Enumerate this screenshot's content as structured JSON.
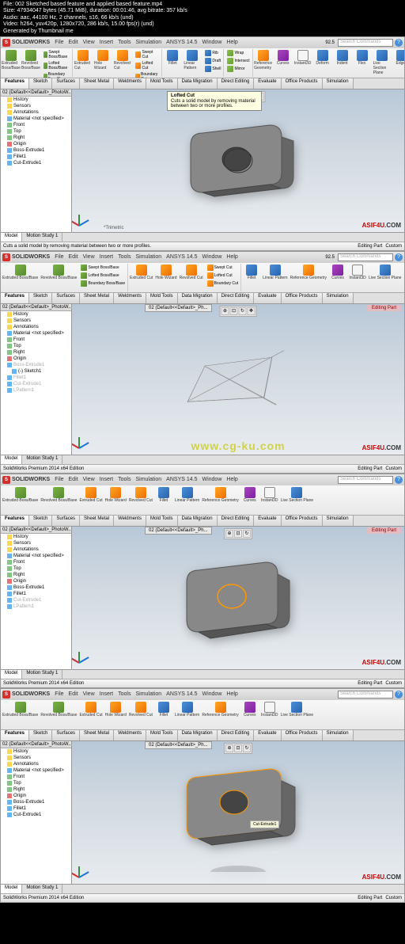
{
  "file_info": {
    "line1": "File: 002 Sketched based feature and applied based feature.mp4",
    "line2": "Size: 47934047 bytes (45.71 MiB), duration: 00:01:46, avg bitrate: 357 kb/s",
    "line3": "Audio: aac, 44100 Hz, 2 channels, s16, 66 kb/s (und)",
    "line4": "Video: h264, yuv420p, 1280x720, 286 kb/s, 15.00 fps(r) (und)",
    "line5": "Generated by Thumbnail me"
  },
  "app": {
    "name": "SOLIDWORKS",
    "search_placeholder": "Search Commands",
    "zoom": "92.5"
  },
  "menu": [
    "File",
    "Edit",
    "View",
    "Insert",
    "Tools",
    "Simulation",
    "ANSYS 14.5",
    "Window",
    "Help"
  ],
  "ribbon": {
    "extruded_boss": "Extruded Boss/Base",
    "revolved_boss": "Revolved Boss/Base",
    "swept_boss": "Swept Boss/Base",
    "lofted_boss": "Lofted Boss/Base",
    "boundary_boss": "Boundary Boss/Base",
    "extruded_cut": "Extruded Cut",
    "hole_wizard": "Hole Wizard",
    "revolved_cut": "Revolved Cut",
    "swept_cut": "Swept Cut",
    "lofted_cut": "Lofted Cut",
    "boundary_cut": "Boundary Cut",
    "fillet": "Fillet",
    "linear_pattern": "Linear Pattern",
    "rib": "Rib",
    "draft": "Draft",
    "shell": "Shell",
    "wrap": "Wrap",
    "intersect": "Intersect",
    "mirror": "Mirror",
    "ref_geometry": "Reference Geometry",
    "curves": "Curves",
    "instant3d": "Instant3D",
    "deform": "Deform",
    "indent": "Indent",
    "flex": "Flex",
    "live_section": "Live Section Plane",
    "edges": "Edges"
  },
  "tabs": [
    "Features",
    "Sketch",
    "Surfaces",
    "Sheet Metal",
    "Weldments",
    "Mold Tools",
    "Data Migration",
    "Direct Editing",
    "Evaluate",
    "Office Products",
    "Simulation"
  ],
  "tree": {
    "root": "02 (Default<<Default>_PhotoW...",
    "history": "History",
    "sensors": "Sensors",
    "annotations": "Annotations",
    "material": "Material <not specified>",
    "front": "Front",
    "top": "Top",
    "right": "Right",
    "origin": "Origin",
    "boss_extrude1": "Boss-Extrude1",
    "fillet1": "Fillet1",
    "cut_extrude1": "Cut-Extrude1",
    "sketch1": "(-) Sketch1",
    "lpattern1": "LPattern1"
  },
  "doc_tab": "02 (Default<<Default>_Ph...",
  "tooltip": {
    "title": "Lofted Cut",
    "desc": "Cuts a solid model by removing material between two or more profiles."
  },
  "viewport": {
    "trimetric": "*Trimetric",
    "editing_part": "Editing Part",
    "custom": "Custom"
  },
  "bottom_tabs": [
    "Model",
    "Motion Study 1"
  ],
  "status": {
    "msg1": "Cuts a solid model by removing material between two or more profiles.",
    "msg2": "SolidWorks Premium 2014 x64 Edition"
  },
  "watermark": {
    "a": "ASIF4U",
    "b": ".COM"
  },
  "center_wm": "www.cg-ku.com",
  "feat_callout": "Cut-Extrude1"
}
